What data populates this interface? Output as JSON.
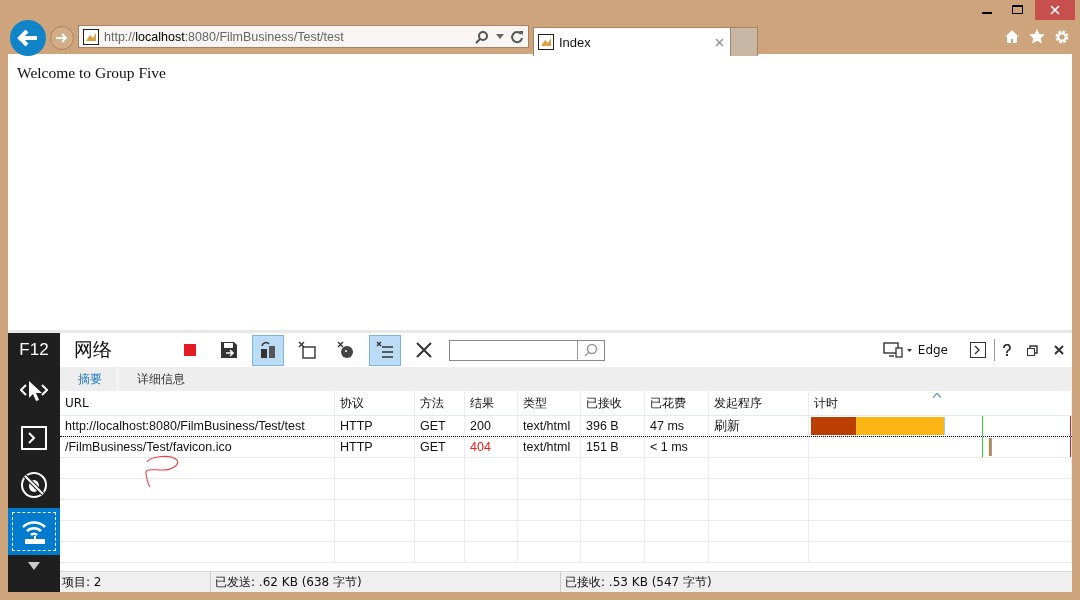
{
  "browser": {
    "address": "http://**localhost**:8080/FilmBusiness/Test/test",
    "tabs": [
      {
        "title": "Index",
        "selected": true
      }
    ]
  },
  "page": {
    "text": "Welcome to Group Five"
  },
  "devtools": {
    "label": "F12",
    "rail": [
      {
        "kind": "dom",
        "selected": false
      },
      {
        "kind": "console",
        "selected": false
      },
      {
        "kind": "debugger",
        "selected": false
      },
      {
        "kind": "network",
        "selected": true
      }
    ],
    "title": "网络",
    "toolbar": [
      {
        "kind": "stop",
        "selected": false
      },
      {
        "kind": "save",
        "selected": false
      },
      {
        "kind": "refresh-cache",
        "selected": true
      },
      {
        "kind": "clear-session",
        "selected": false
      },
      {
        "kind": "clear-cookies",
        "selected": false
      },
      {
        "kind": "filter",
        "selected": true
      },
      {
        "kind": "clear",
        "selected": false
      }
    ],
    "mode": "Edge",
    "subtabs": [
      {
        "label": "摘要",
        "selected": true
      },
      {
        "label": "详细信息",
        "selected": false
      }
    ],
    "columns": [
      "URL",
      "协议",
      "方法",
      "结果",
      "类型",
      "已接收",
      "已花费",
      "发起程序",
      "计时"
    ],
    "rows": [
      {
        "url": "http://localhost:8080/FilmBusiness/Test/test",
        "protocol": "HTTP",
        "method": "GET",
        "result": "200",
        "error": false,
        "type": "text/html",
        "received": "396 B",
        "taken": "47 ms",
        "initiator": "刷新",
        "selected": false
      },
      {
        "url": "/FilmBusiness/Test/favicon.ico",
        "protocol": "HTTP",
        "method": "GET",
        "result": "404",
        "error": true,
        "type": "text/html",
        "received": "151 B",
        "taken": "< 1 ms",
        "initiator": "",
        "selected": true
      }
    ],
    "status": [
      "项目: 2",
      "已发送: .62 KB (638 字节)",
      "已接收: .53 KB (547 字节)"
    ]
  }
}
